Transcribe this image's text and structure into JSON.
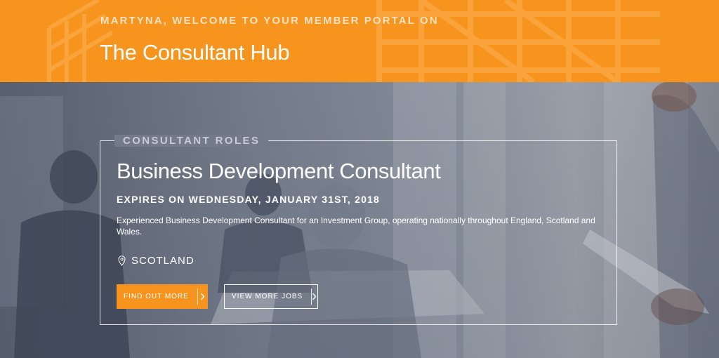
{
  "header": {
    "welcome_text": "MARTYNA, WELCOME TO YOUR MEMBER PORTAL ON",
    "site_title": "The Consultant Hub",
    "background_color": "#f7941d"
  },
  "job": {
    "section_label": "CONSULTANT ROLES",
    "title": "Business Development Consultant",
    "expires": "EXPIRES ON WEDNESDAY, JANUARY 31ST, 2018",
    "description": "Experienced Business Development Consultant for an Investment Group, operating nationally throughout England, Scotland and Wales.",
    "location_icon": "map-pin-icon",
    "location": "SCOTLAND"
  },
  "actions": {
    "find_out_more": "FIND OUT MORE",
    "view_more_jobs": "VIEW MORE JOBS",
    "arrow_icon": "chevron-right-icon",
    "accent_color": "#f7941d"
  }
}
